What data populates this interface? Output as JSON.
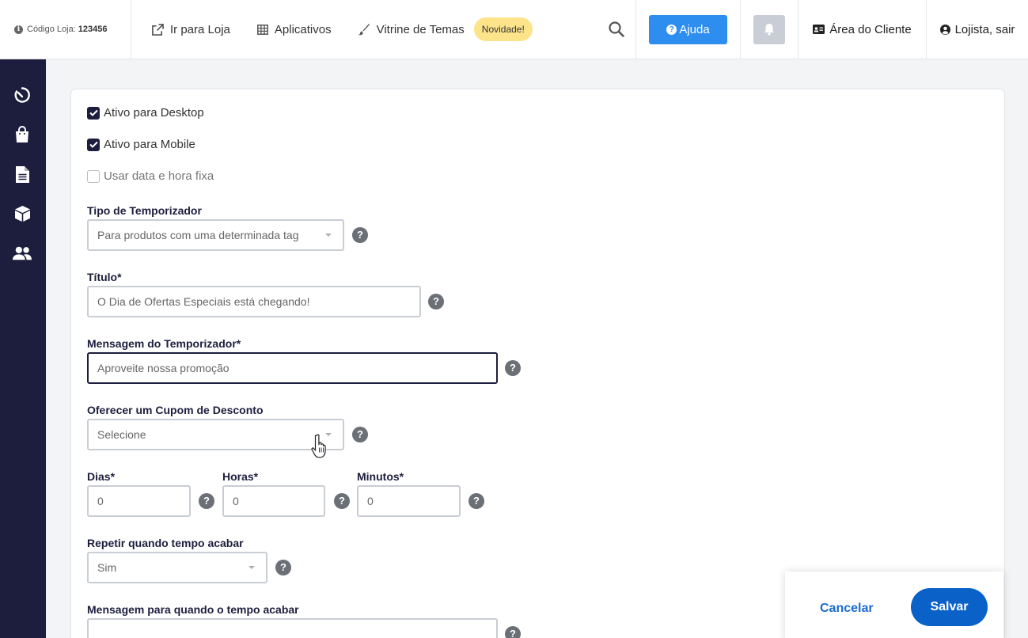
{
  "topbar": {
    "store_code_label": "Código Loja:",
    "store_code_value": "123456",
    "nav": [
      {
        "label": "Ir para Loja",
        "icon": "external-link-icon"
      },
      {
        "label": "Aplicativos",
        "icon": "grid-icon"
      },
      {
        "label": "Vitrine de Temas",
        "icon": "brush-icon"
      }
    ],
    "new_badge": "Novidade!",
    "help_label": "Ajuda",
    "client_area_label": "Área do Cliente",
    "user_label": "Lojista, sair"
  },
  "sidebar": {
    "icons": [
      "speedometer-icon",
      "shopping-bag-icon",
      "document-icon",
      "box-icon",
      "users-icon"
    ]
  },
  "form": {
    "active_desktop": {
      "label": "Ativo para Desktop",
      "checked": true
    },
    "active_mobile": {
      "label": "Ativo para Mobile",
      "checked": true
    },
    "fixed_datetime": {
      "label": "Usar data e hora fixa",
      "checked": false
    },
    "timer_type": {
      "label": "Tipo de Temporizador",
      "value": "Para produtos com uma determinada tag"
    },
    "title": {
      "label": "Título*",
      "value": "O Dia de Ofertas Especiais está chegando!"
    },
    "message": {
      "label": "Mensagem do Temporizador*",
      "value": "Aproveite nossa promoção"
    },
    "coupon": {
      "label": "Oferecer um Cupom de Desconto",
      "value": "Selecione"
    },
    "days": {
      "label": "Dias*",
      "value": "0"
    },
    "hours": {
      "label": "Horas*",
      "value": "0"
    },
    "minutes": {
      "label": "Minutos*",
      "value": "0"
    },
    "repeat": {
      "label": "Repetir quando tempo acabar",
      "value": "Sim"
    },
    "end_message": {
      "label": "Mensagem para quando o tempo acabar",
      "value": ""
    },
    "help_glyph": "?"
  },
  "actions": {
    "cancel_label": "Cancelar",
    "save_label": "Salvar"
  },
  "colors": {
    "sidebar_bg": "#1d1e3d",
    "primary": "#0a62c9",
    "help_button": "#2d8ef0",
    "badge": "#fde48a"
  }
}
